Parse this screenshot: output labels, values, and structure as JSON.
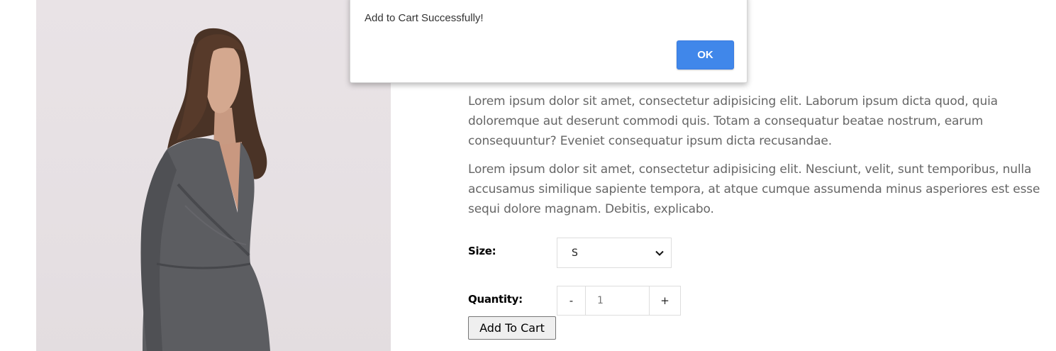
{
  "product": {
    "image_alt": "Model wearing a long-sleeve grey glitter wrap dress",
    "description_1": "Lorem ipsum dolor sit amet, consectetur adipisicing elit. Laborum ipsum dicta quod, quia doloremque aut deserunt commodi quis. Totam a consequatur beatae nostrum, earum consequuntur? Eveniet consequatur ipsum dicta recusandae.",
    "description_2": "Lorem ipsum dolor sit amet, consectetur adipisicing elit. Nesciunt, velit, sunt temporibus, nulla accusamus similique sapiente tempora, at atque cumque assumenda minus asperiores est esse sequi dolore magnam. Debitis, explicabo."
  },
  "size": {
    "label": "Size:",
    "selected": "S",
    "icon": "chevron-down-icon"
  },
  "quantity": {
    "label": "Quantity:",
    "minus": "-",
    "value": "1",
    "plus": "+"
  },
  "cart": {
    "add_label": "Add To Cart"
  },
  "dialog": {
    "message": "Add to Cart Successfully!",
    "ok_label": "OK",
    "ok_color": "#4087ea"
  }
}
